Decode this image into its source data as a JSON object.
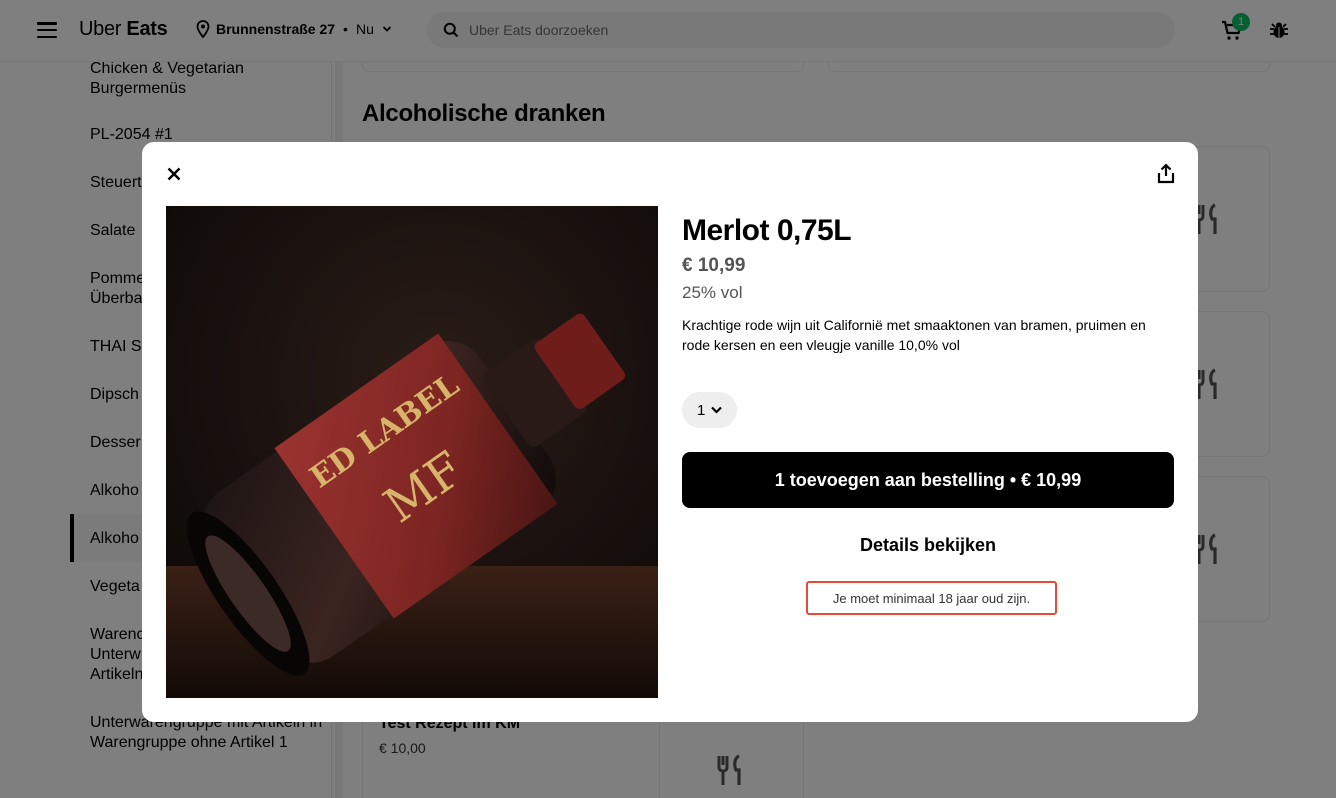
{
  "header": {
    "logo_light": "Uber",
    "logo_bold": "Eats",
    "location": "Brunnenstraße 27",
    "separator": "•",
    "delivery_time": "Nu",
    "search_placeholder": "Uber Eats doorzoeken",
    "cart_count": "1"
  },
  "sidebar": {
    "items": [
      {
        "label": "Chicken & Vegetarian Burgermenüs"
      },
      {
        "label": "PL-2054 #1"
      },
      {
        "label": "Steuert"
      },
      {
        "label": "Salate"
      },
      {
        "label": "Pomme Überba"
      },
      {
        "label": "THAI Sc"
      },
      {
        "label": "Dipsch"
      },
      {
        "label": "Desser"
      },
      {
        "label": "Alkoho"
      },
      {
        "label": "Alkoho"
      },
      {
        "label": "Vegeta"
      },
      {
        "label": "Warenc Unterw Artikeln"
      },
      {
        "label": "Unterwarengruppe mit Artikeln in Warengruppe ohne Artikel 1"
      }
    ],
    "active_index": 9
  },
  "main": {
    "section_title": "Alcoholische dranken",
    "visible_item": {
      "name": "Test Rezept im KM",
      "price": "€ 10,00"
    }
  },
  "modal": {
    "title": "Merlot 0,75L",
    "price": "€ 10,99",
    "volume": "25% vol",
    "description": "Krachtige rode wijn uit Californië met smaaktonen van bramen, pruimen en rode kersen en een vleugje vanille 10,0% vol",
    "quantity": "1",
    "add_button": "1 toevoegen aan bestelling • € 10,99",
    "details_button": "Details bekijken",
    "age_warning": "Je moet minimaal 18 jaar oud zijn."
  },
  "colors": {
    "accent_green": "#06c167",
    "warning_red": "#e64a3b",
    "bottle_label": "#8b2a27",
    "label_gold": "#d8b36a"
  }
}
